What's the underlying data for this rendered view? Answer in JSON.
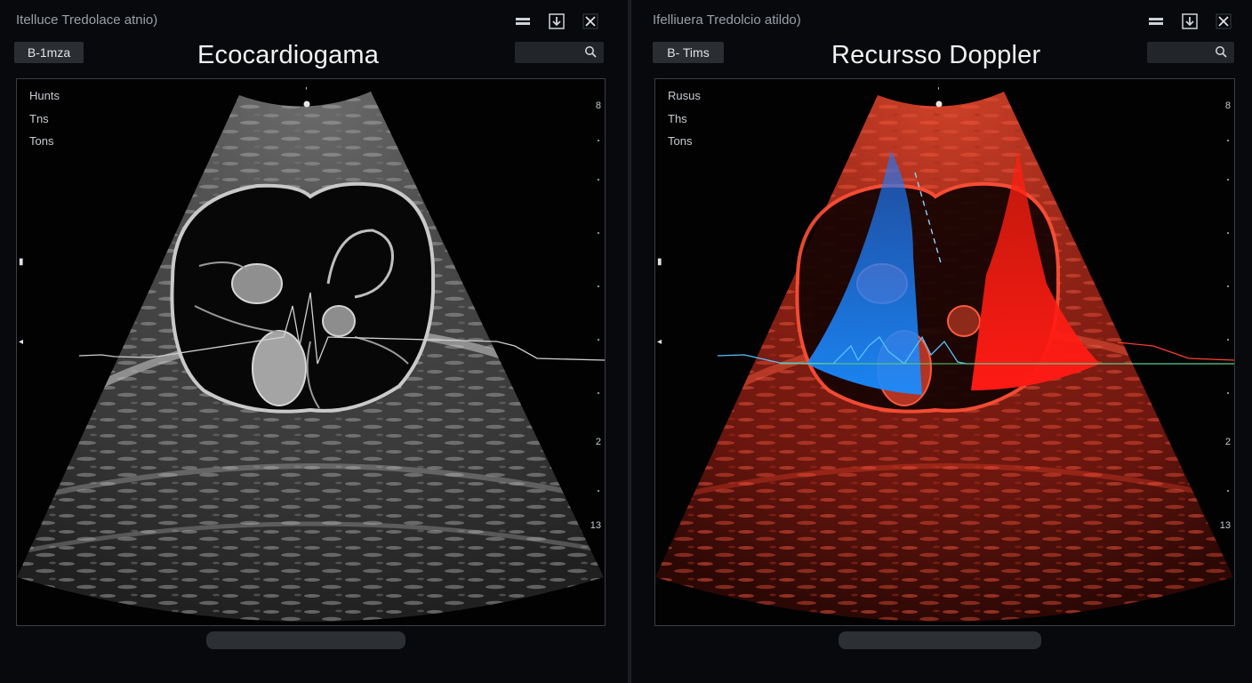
{
  "left_window": {
    "title": "Itelluce Tredolace atnio)",
    "mode_label": "B-1mza",
    "view_title": "Ecocardiogama",
    "params": [
      "Hunts",
      "Tns",
      "Tons"
    ],
    "scale_labels": [
      "8",
      "2",
      "13"
    ],
    "controls": {
      "minimize_icon": "minimize-icon",
      "download_icon": "download-icon",
      "close_icon": "close-icon"
    },
    "search_icon": "search-icon",
    "image_style": "grayscale"
  },
  "right_window": {
    "title": "Ifelliuera Tredolcio atildo)",
    "mode_label": "B- Tims",
    "view_title": "Recursso Doppler",
    "params": [
      "Rusus",
      "Ths",
      "Tons"
    ],
    "scale_labels": [
      "8",
      "2",
      "13"
    ],
    "controls": {
      "minimize_icon": "minimize-icon",
      "download_icon": "download-icon",
      "close_icon": "close-icon"
    },
    "search_icon": "search-icon",
    "image_style": "color-doppler",
    "colors": {
      "flow_toward": "#ff1a14",
      "flow_away": "#1a7dff",
      "tissue_tint": "#c83420"
    }
  }
}
